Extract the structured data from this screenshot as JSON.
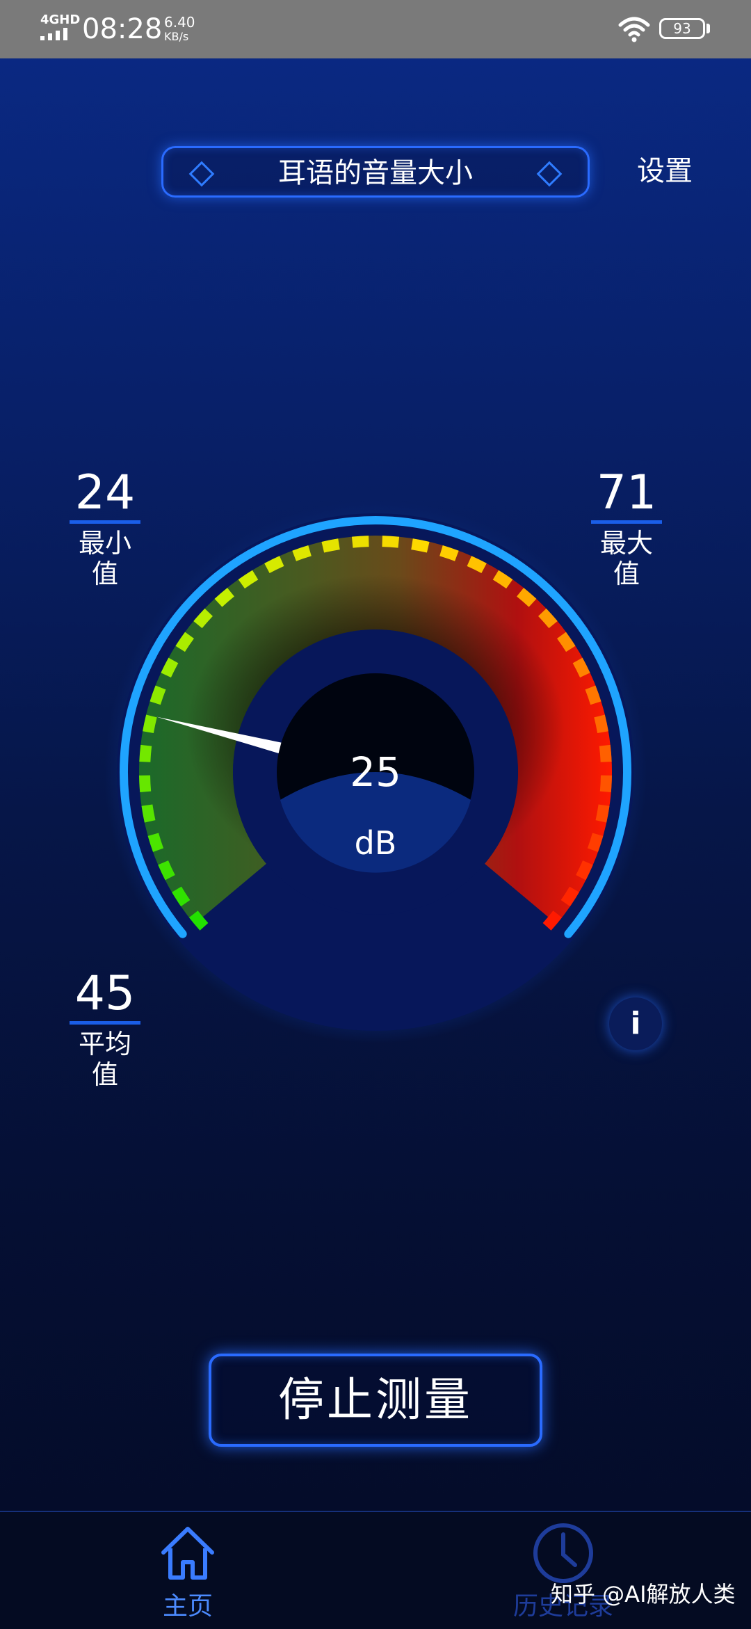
{
  "status_bar": {
    "network": "4GHD",
    "time": "08:28",
    "speed_value": "6.40",
    "speed_unit": "KB/s",
    "battery": "93"
  },
  "header": {
    "mode_label": "耳语的音量大小",
    "settings_label": "设置"
  },
  "stats": {
    "min": {
      "value": "24",
      "label": "最小值"
    },
    "max": {
      "value": "71",
      "label": "最大值"
    },
    "avg": {
      "value": "45",
      "label": "平均值"
    }
  },
  "gauge": {
    "value": "25",
    "unit": "dB",
    "scale_min": 0,
    "scale_max": 120,
    "reading": 25
  },
  "info_button": {
    "label": "i"
  },
  "action": {
    "stop_label": "停止测量"
  },
  "bottom_nav": {
    "home_label": "主页",
    "history_label": "历史记录"
  },
  "watermark": "知乎 @AI解放人类",
  "colors": {
    "accent": "#2a6bff",
    "ring": "#1fa4ff",
    "low": "#22e000",
    "mid": "#ffd800",
    "high": "#ff1a00"
  }
}
